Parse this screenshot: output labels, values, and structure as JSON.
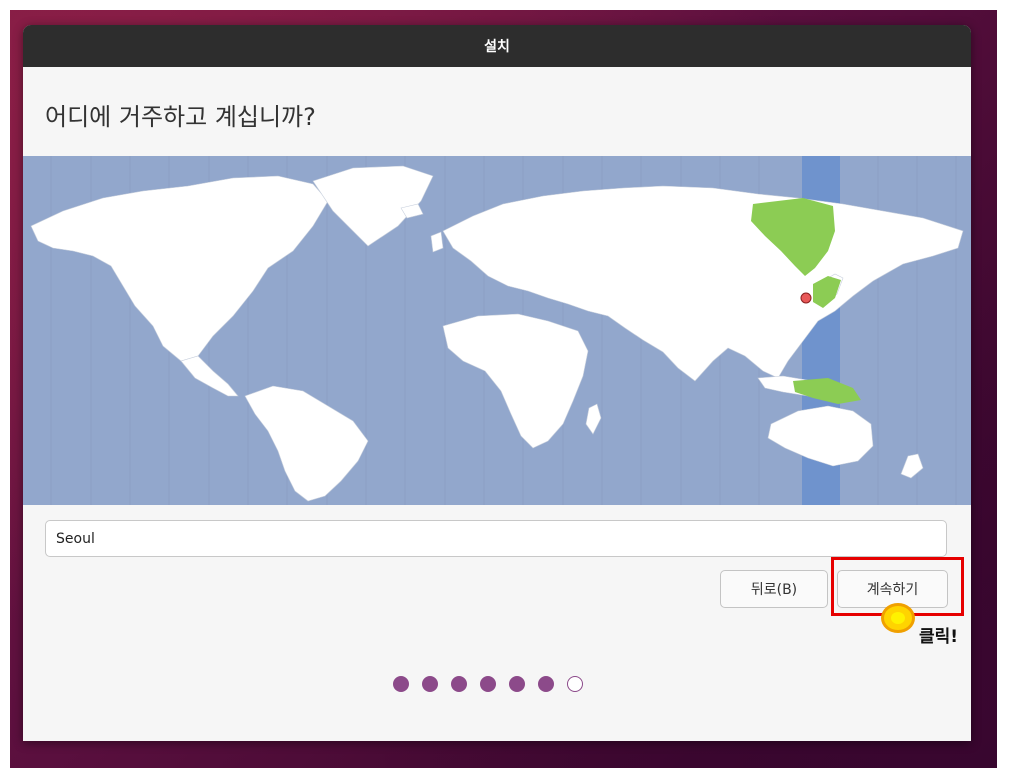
{
  "window": {
    "title": "설치"
  },
  "page": {
    "heading": "어디에 거주하고 계십니까?"
  },
  "map": {
    "ocean_color": "#92a7cc",
    "land_color": "#ffffff",
    "selected_zone_color": "#6f93cd",
    "highlight_land_color": "#8ccc54",
    "pin_color": "#e85858"
  },
  "location": {
    "value": "Seoul"
  },
  "buttons": {
    "back": "뒤로(B)",
    "continue": "계속하기"
  },
  "progress": {
    "total_steps": 7,
    "current_step": 7
  },
  "annotation": {
    "text": "클릭!",
    "box_color": "#e60000",
    "marker_color": "#ffd400"
  }
}
